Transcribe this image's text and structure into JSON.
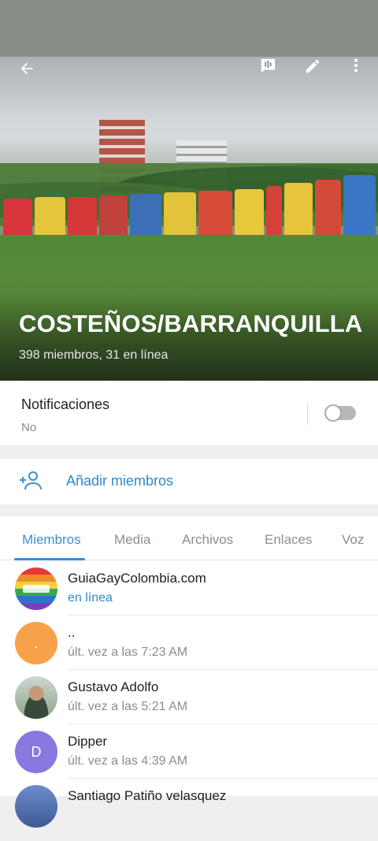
{
  "header": {
    "group_name": "COSTEÑOS/BARRANQUILLA",
    "subtitle": "398 miembros, 31 en línea",
    "icons": [
      "back-arrow-icon",
      "voice-chat-icon",
      "edit-pencil-icon",
      "more-vertical-icon"
    ]
  },
  "notifications": {
    "title": "Notificaciones",
    "value": "No",
    "enabled": false
  },
  "add_members": {
    "label": "Añadir miembros",
    "icon": "add-user-icon"
  },
  "tabs": [
    {
      "label": "Miembros",
      "active": true
    },
    {
      "label": "Media",
      "active": false
    },
    {
      "label": "Archivos",
      "active": false
    },
    {
      "label": "Enlaces",
      "active": false
    },
    {
      "label": "Voz",
      "active": false
    }
  ],
  "members": [
    {
      "name": "GuiaGayColombia.com",
      "status": "en línea",
      "online": true,
      "avatar": "rainbow-flag"
    },
    {
      "name": "..",
      "status": "últ. vez a las 7:23 AM",
      "online": false,
      "avatar": "initial",
      "initial": "."
    },
    {
      "name": "Gustavo Adolfo",
      "status": "últ. vez a las 5:21 AM",
      "online": false,
      "avatar": "photo"
    },
    {
      "name": "Dipper",
      "status": "últ. vez a las 4:39 AM",
      "online": false,
      "avatar": "initial",
      "initial": "D"
    },
    {
      "name": "Santiago Patiño velasquez",
      "status": "",
      "online": false,
      "avatar": "photo"
    }
  ],
  "colors": {
    "accent": "#3a8fd0",
    "avatar_orange": "#f7a24a",
    "avatar_purple": "#8a77e0"
  }
}
